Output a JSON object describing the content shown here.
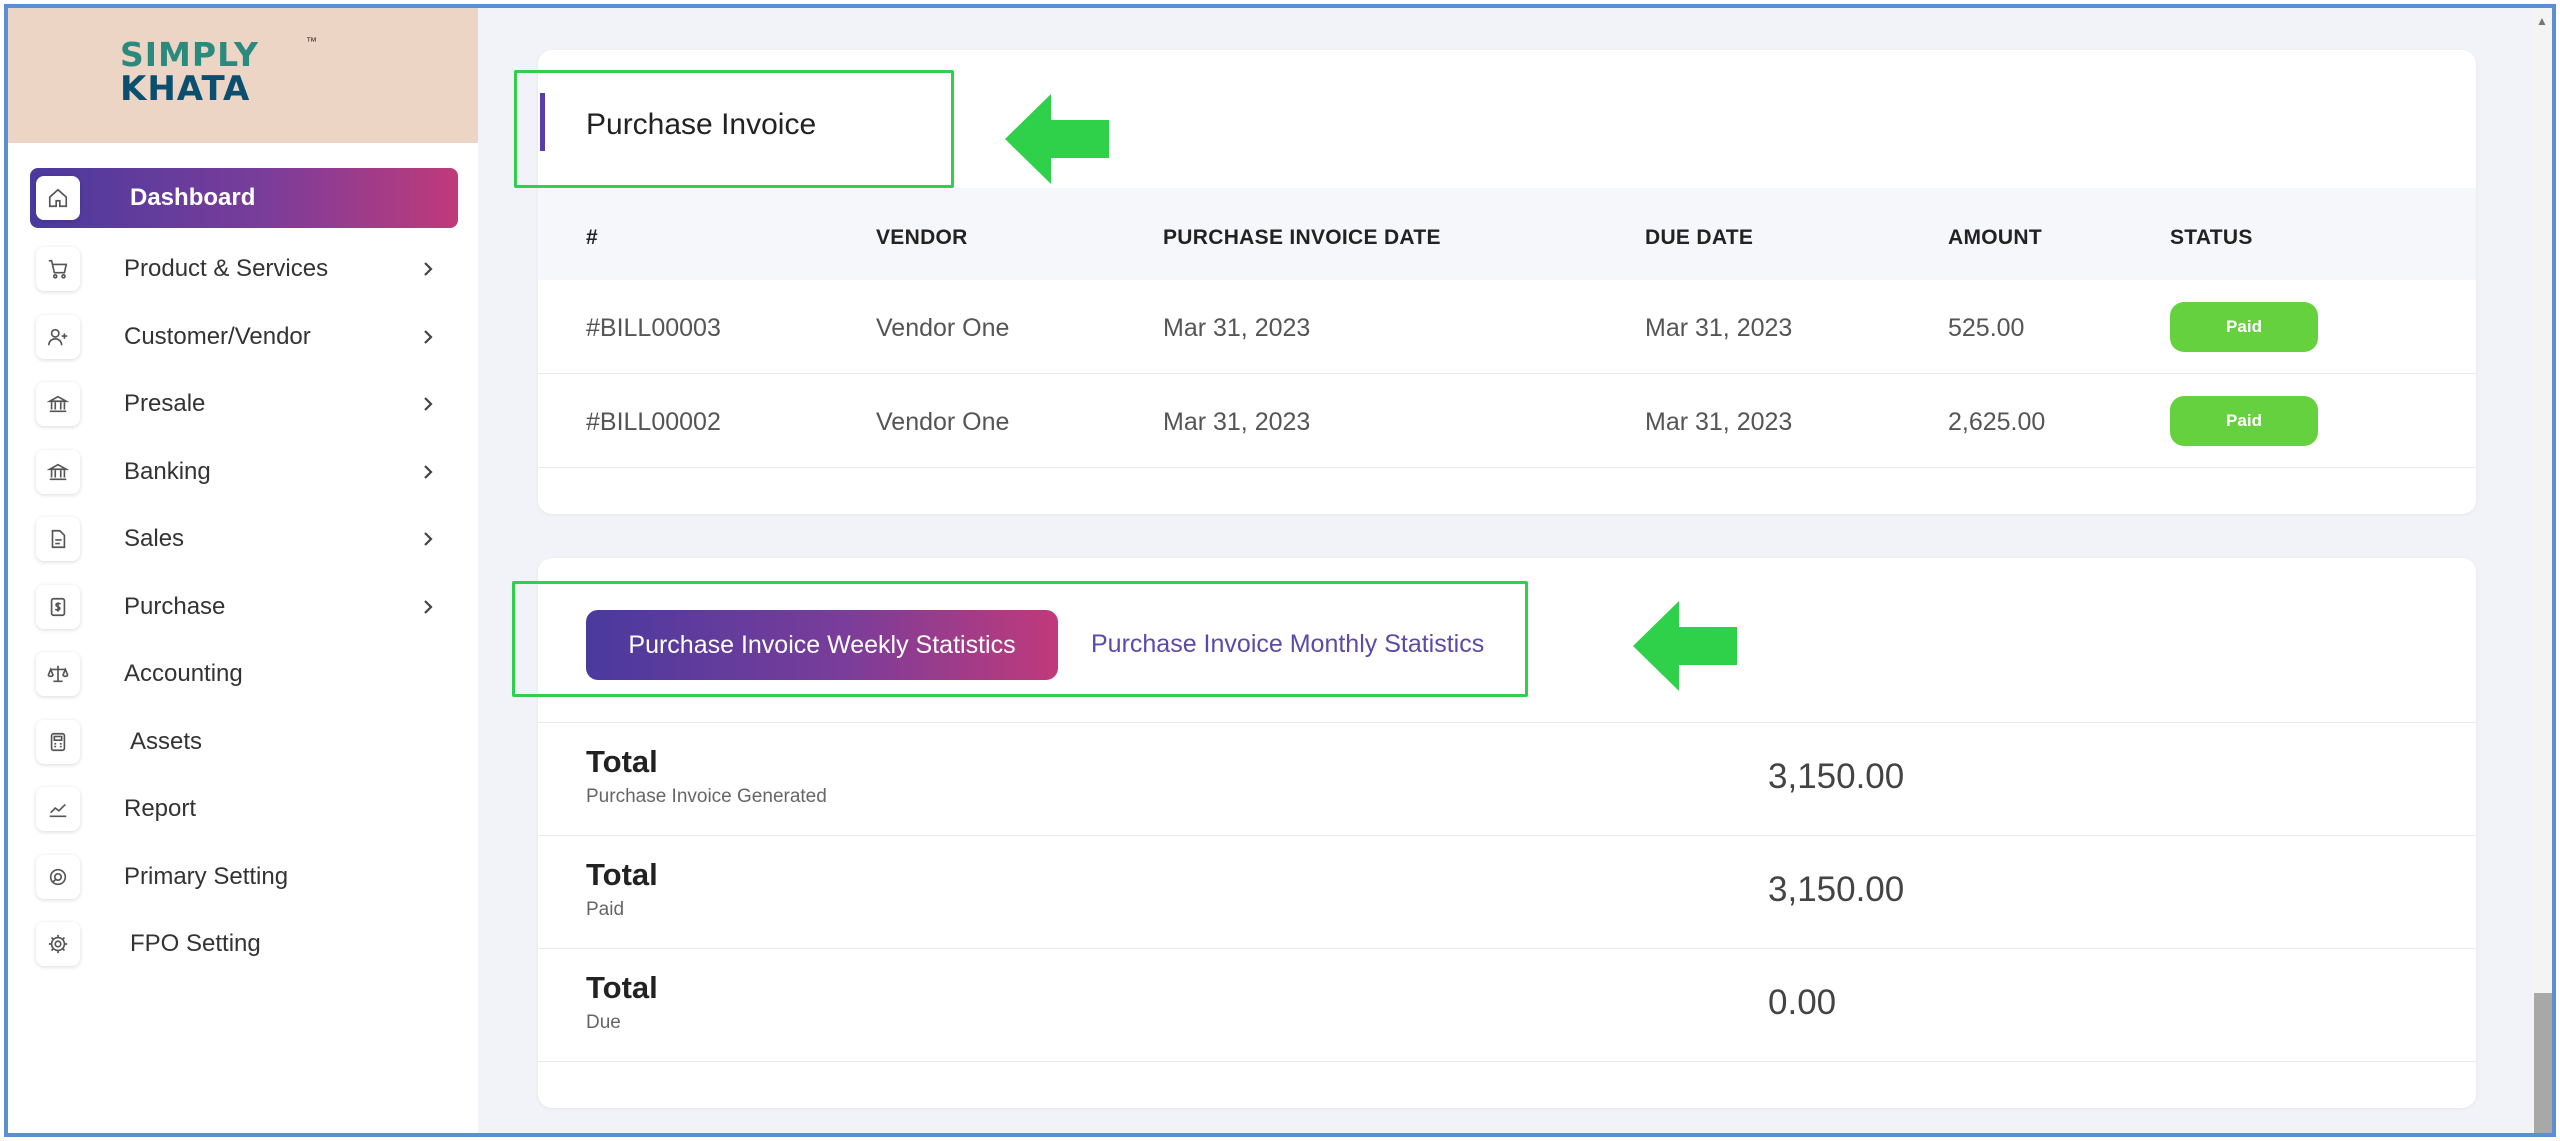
{
  "brand": {
    "logo_line1": "SIMPLY",
    "logo_line2": "KHATA",
    "trademark": "™"
  },
  "sidebar": {
    "items": [
      {
        "label": "Dashboard",
        "icon": "home-icon",
        "active": true
      },
      {
        "label": "Product & Services",
        "icon": "cart-icon"
      },
      {
        "label": "Customer/Vendor",
        "icon": "user-plus-icon"
      },
      {
        "label": "Presale",
        "icon": "bank-icon"
      },
      {
        "label": "Banking",
        "icon": "bank-icon"
      },
      {
        "label": "Sales",
        "icon": "document-icon"
      },
      {
        "label": "Purchase",
        "icon": "receipt-icon"
      },
      {
        "label": "Accounting",
        "icon": "scale-icon"
      },
      {
        "label": "Assets",
        "icon": "calculator-icon"
      },
      {
        "label": "Report",
        "icon": "chart-line-icon"
      },
      {
        "label": "Primary Setting",
        "icon": "settings-circle-icon"
      },
      {
        "label": "FPO Setting",
        "icon": "gear-icon"
      }
    ]
  },
  "purchase_invoice": {
    "title": "Purchase Invoice",
    "columns": [
      "#",
      "VENDOR",
      "PURCHASE INVOICE DATE",
      "DUE DATE",
      "AMOUNT",
      "STATUS"
    ],
    "rows": [
      {
        "id": "#BILL00003",
        "vendor": "Vendor One",
        "invoice_date": "Mar 31, 2023",
        "due_date": "Mar 31, 2023",
        "amount": "525.00",
        "status": "Paid"
      },
      {
        "id": "#BILL00002",
        "vendor": "Vendor One",
        "invoice_date": "Mar 31, 2023",
        "due_date": "Mar 31, 2023",
        "amount": "2,625.00",
        "status": "Paid"
      }
    ]
  },
  "statistics": {
    "tabs": [
      {
        "label": "Purchase Invoice Weekly Statistics",
        "active": true
      },
      {
        "label": "Purchase Invoice Monthly Statistics",
        "active": false
      }
    ],
    "rows": [
      {
        "label": "Total",
        "sub": "Purchase Invoice Generated",
        "value": "3,150.00"
      },
      {
        "label": "Total",
        "sub": "Paid",
        "value": "3,150.00"
      },
      {
        "label": "Total",
        "sub": "Due",
        "value": "0.00"
      }
    ]
  },
  "colors": {
    "accent_gradient_start": "#4a3a9e",
    "accent_gradient_end": "#c03a7a",
    "status_paid": "#66d13f",
    "annotation_green": "#2fd04a"
  }
}
